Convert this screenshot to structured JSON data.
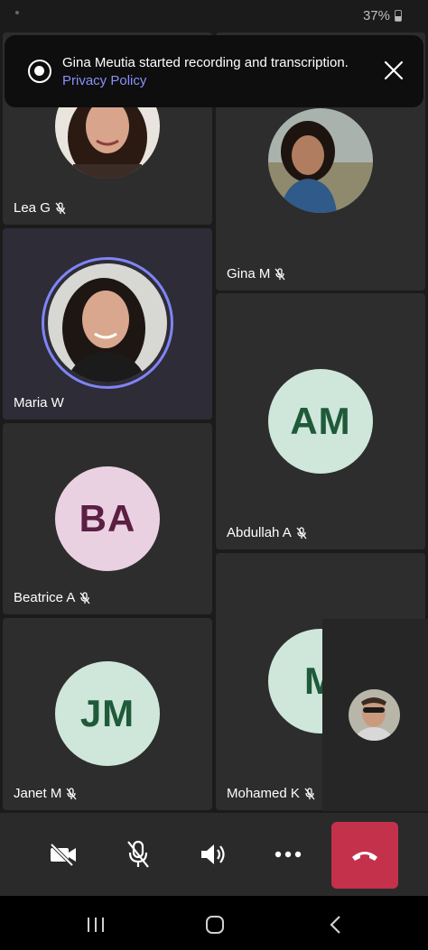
{
  "status_bar": {
    "battery": "37%"
  },
  "notification": {
    "message": "Gina Meutia started recording and transcription.",
    "link": "Privacy Policy"
  },
  "participants": [
    {
      "name": "Lea G",
      "muted": true
    },
    {
      "name": "Gina M",
      "muted": true
    },
    {
      "name": "Maria W",
      "muted": false,
      "speaking": true
    },
    {
      "name": "Abdullah A",
      "initials": "AM",
      "muted": true
    },
    {
      "name": "Beatrice A",
      "initials": "BA",
      "muted": true
    },
    {
      "name": "Janet M",
      "initials": "JM",
      "muted": true
    },
    {
      "name": "Mohamed K",
      "initials": "M",
      "muted": true
    }
  ],
  "controls": {
    "camera": "camera-off-icon",
    "mic": "mic-off-icon",
    "speaker": "speaker-icon",
    "more": "more-options-icon",
    "end_call": "hang-up-icon"
  },
  "colors": {
    "accent": "#7f85f5",
    "end_call": "#c4314b",
    "link": "#8b90f8"
  }
}
